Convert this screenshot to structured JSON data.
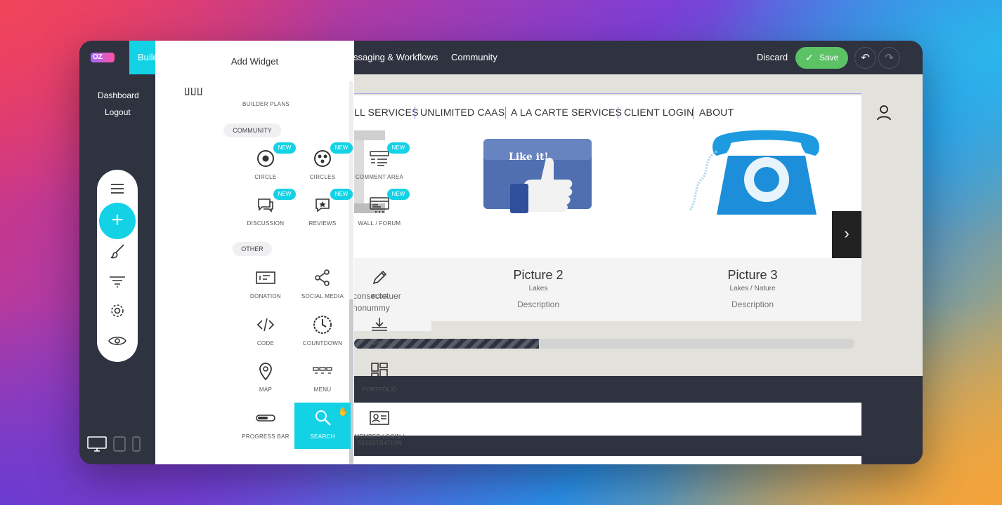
{
  "app": {
    "logo": "OZ"
  },
  "topbar": {
    "build_tab": "Build",
    "messaging": "ssaging & Workflows",
    "community": "Community",
    "discard": "Discard",
    "save": "Save"
  },
  "sidebar": {
    "dashboard": "Dashboard",
    "logout": "Logout"
  },
  "panel": {
    "title": "Add Widget",
    "builder_plans": "BUILDER PLANS",
    "section_community": "COMMUNITY",
    "section_other": "OTHER",
    "new_badge": "NEW",
    "community_widgets": [
      "CIRCLE",
      "CIRCLES",
      "COMMENT AREA",
      "DISCUSSION",
      "REVIEWS",
      "WALL / FORUM"
    ],
    "other_widgets": [
      "DONATION",
      "SOCIAL MEDIA",
      "BLOG",
      "CODE",
      "COUNTDOWN",
      "EMBED",
      "MAP",
      "MENU",
      "PORTFOLIO",
      "PROGRESS BAR",
      "SEARCH",
      "MEMBER LOGIN /",
      "REGISTRATION"
    ]
  },
  "site": {
    "nav": [
      "LL SERVICES",
      "UNLIMITED CAAS",
      "A LA CARTE SERVICES",
      "CLIENT LOGIN",
      "ABOUT"
    ],
    "like_sign": "Like it!",
    "pictures": [
      {
        "title": "",
        "subtitle": "",
        "desc_line1": "consectetuer",
        "desc_line2": "nonummy"
      },
      {
        "title": "Picture 2",
        "subtitle": "Lakes",
        "desc": "Description"
      },
      {
        "title": "Picture 3",
        "subtitle": "Lakes / Nature",
        "desc": "Description"
      }
    ],
    "progress_fraction": 0.37
  },
  "colors": {
    "accent": "#14d2e6",
    "save": "#5cc266",
    "chrome": "#2f3340"
  }
}
